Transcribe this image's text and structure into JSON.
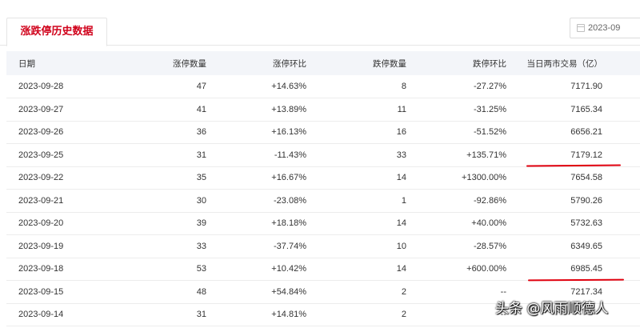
{
  "tab": {
    "label": "涨跌停历史数据"
  },
  "date_picker": {
    "value": "2023-09"
  },
  "table": {
    "headers": [
      "日期",
      "涨停数量",
      "涨停环比",
      "跌停数量",
      "跌停环比",
      "当日两市交易（亿）"
    ],
    "rows": [
      {
        "date": "2023-09-28",
        "limit_up": "47",
        "limit_up_ratio": "+14.63%",
        "limit_down": "8",
        "limit_down_ratio": "-27.27%",
        "volume": "7171.90"
      },
      {
        "date": "2023-09-27",
        "limit_up": "41",
        "limit_up_ratio": "+13.89%",
        "limit_down": "11",
        "limit_down_ratio": "-31.25%",
        "volume": "7165.34"
      },
      {
        "date": "2023-09-26",
        "limit_up": "36",
        "limit_up_ratio": "+16.13%",
        "limit_down": "16",
        "limit_down_ratio": "-51.52%",
        "volume": "6656.21"
      },
      {
        "date": "2023-09-25",
        "limit_up": "31",
        "limit_up_ratio": "-11.43%",
        "limit_down": "33",
        "limit_down_ratio": "+135.71%",
        "volume": "7179.12"
      },
      {
        "date": "2023-09-22",
        "limit_up": "35",
        "limit_up_ratio": "+16.67%",
        "limit_down": "14",
        "limit_down_ratio": "+1300.00%",
        "volume": "7654.58"
      },
      {
        "date": "2023-09-21",
        "limit_up": "30",
        "limit_up_ratio": "-23.08%",
        "limit_down": "1",
        "limit_down_ratio": "-92.86%",
        "volume": "5790.26"
      },
      {
        "date": "2023-09-20",
        "limit_up": "39",
        "limit_up_ratio": "+18.18%",
        "limit_down": "14",
        "limit_down_ratio": "+40.00%",
        "volume": "5732.63"
      },
      {
        "date": "2023-09-19",
        "limit_up": "33",
        "limit_up_ratio": "-37.74%",
        "limit_down": "10",
        "limit_down_ratio": "-28.57%",
        "volume": "6349.65"
      },
      {
        "date": "2023-09-18",
        "limit_up": "53",
        "limit_up_ratio": "+10.42%",
        "limit_down": "14",
        "limit_down_ratio": "+600.00%",
        "volume": "6985.45"
      },
      {
        "date": "2023-09-15",
        "limit_up": "48",
        "limit_up_ratio": "+54.84%",
        "limit_down": "2",
        "limit_down_ratio": "--",
        "volume": "7217.34"
      },
      {
        "date": "2023-09-14",
        "limit_up": "31",
        "limit_up_ratio": "+14.81%",
        "limit_down": "2",
        "limit_down_ratio": "--",
        "volume": ""
      }
    ]
  },
  "colors": {
    "up": "#e93030",
    "down": "#1aa054",
    "flat": "#999999",
    "accent": "#d0021b",
    "mark": "#e0000e"
  },
  "watermark": {
    "text": "头条 @风雨顺德人"
  }
}
